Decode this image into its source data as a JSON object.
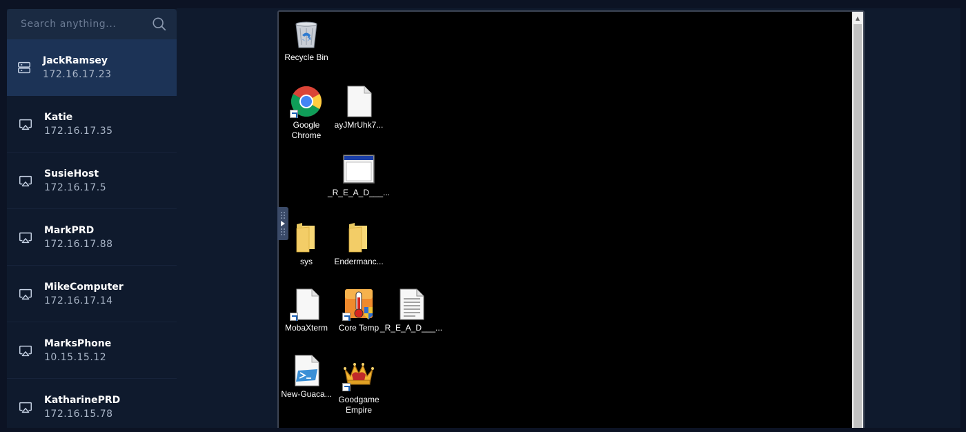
{
  "search": {
    "placeholder": "Search anything..."
  },
  "hosts": [
    {
      "name": "JackRamsey",
      "ip": "172.16.17.23",
      "icon": "server-icon",
      "active": true
    },
    {
      "name": "Katie",
      "ip": "172.16.17.35",
      "icon": "remote-display-icon"
    },
    {
      "name": "SusieHost",
      "ip": "172.16.17.5",
      "icon": "remote-display-icon"
    },
    {
      "name": "MarkPRD",
      "ip": "172.16.17.88",
      "icon": "remote-display-icon"
    },
    {
      "name": "MikeComputer",
      "ip": "172.16.17.14",
      "icon": "remote-display-icon"
    },
    {
      "name": "MarksPhone",
      "ip": "10.15.15.12",
      "icon": "remote-display-icon"
    },
    {
      "name": "KatharinePRD",
      "ip": "172.16.15.78",
      "icon": "remote-display-icon"
    }
  ],
  "desktop": {
    "icons": [
      {
        "label": "Recycle Bin",
        "icon": "recycle-bin-icon"
      },
      {
        "label": "Google Chrome",
        "icon": "chrome-icon"
      },
      {
        "label": "ayJMrUhk7...",
        "icon": "blank-file-icon"
      },
      {
        "label": "_R_E_A_D___...",
        "icon": "window-app-icon"
      },
      {
        "label": "sys",
        "icon": "folder-icon"
      },
      {
        "label": "Endermanc...",
        "icon": "folder-icon"
      },
      {
        "label": "MobaXterm",
        "icon": "blank-file-icon"
      },
      {
        "label": "Core Temp",
        "icon": "core-temp-icon"
      },
      {
        "label": "_R_E_A_D___...",
        "icon": "text-file-icon"
      },
      {
        "label": "New-Guaca...",
        "icon": "powershell-script-icon"
      },
      {
        "label": "Goodgame Empire",
        "icon": "crown-icon"
      }
    ]
  },
  "colors": {
    "background": "#0c1324",
    "sidebar": "#0f1a2d",
    "active_item": "#1c3356",
    "search_bg": "#1a2a42"
  }
}
